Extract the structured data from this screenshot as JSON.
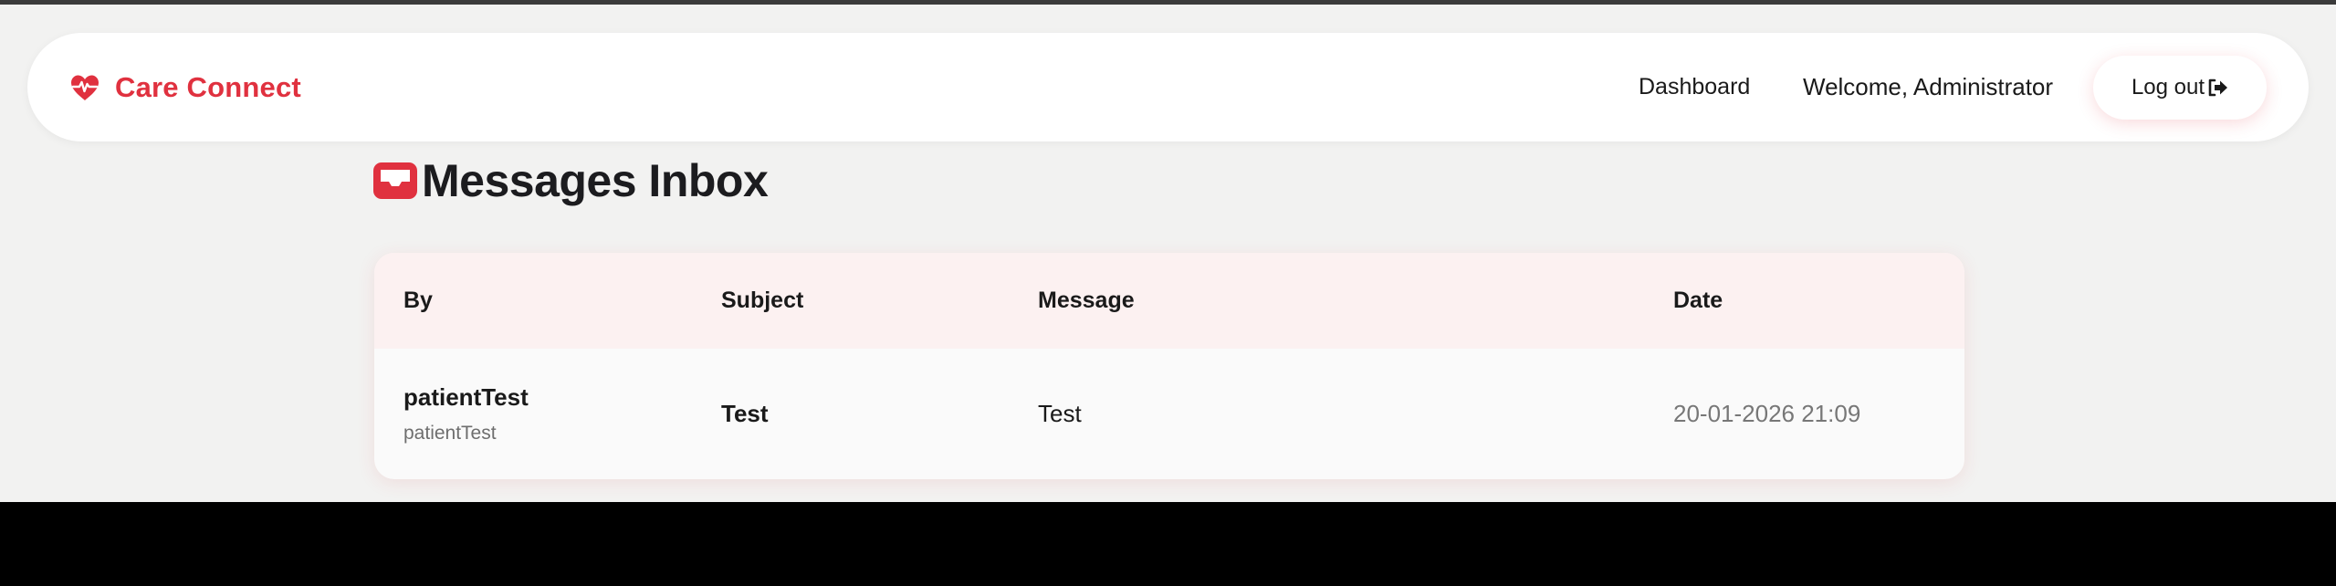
{
  "app": {
    "brand": "Care Connect",
    "brand_icon": "heart-pulse-icon",
    "accent_color": "#e0313f"
  },
  "nav": {
    "dashboard": "Dashboard",
    "welcome": "Welcome, Administrator",
    "logout": "Log out",
    "logout_icon": "sign-out-icon"
  },
  "page": {
    "title": "Messages Inbox",
    "title_icon": "inbox-icon"
  },
  "table": {
    "headers": {
      "by": "By",
      "subject": "Subject",
      "message": "Message",
      "date": "Date"
    },
    "rows": [
      {
        "by_name": "patientTest",
        "by_username": "patientTest",
        "subject": "Test",
        "message": "Test",
        "date": "20-01-2026 21:09"
      }
    ]
  }
}
